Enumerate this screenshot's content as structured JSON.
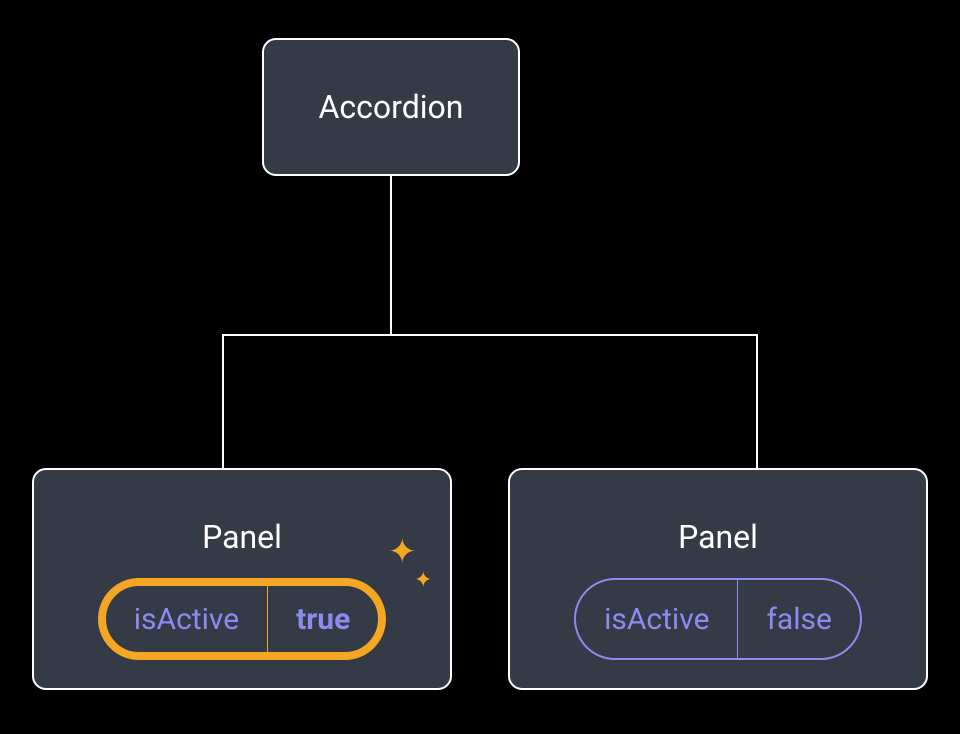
{
  "nodes": {
    "root": {
      "label": "Accordion"
    },
    "panel_left": {
      "label": "Panel",
      "prop_name": "isActive",
      "prop_value": "true",
      "highlighted": true
    },
    "panel_right": {
      "label": "Panel",
      "prop_name": "isActive",
      "prop_value": "false",
      "highlighted": false
    }
  },
  "colors": {
    "node_bg": "#343a46",
    "node_border": "#ffffff",
    "highlight": "#f5a623",
    "prop_text": "#8b8bf0"
  }
}
